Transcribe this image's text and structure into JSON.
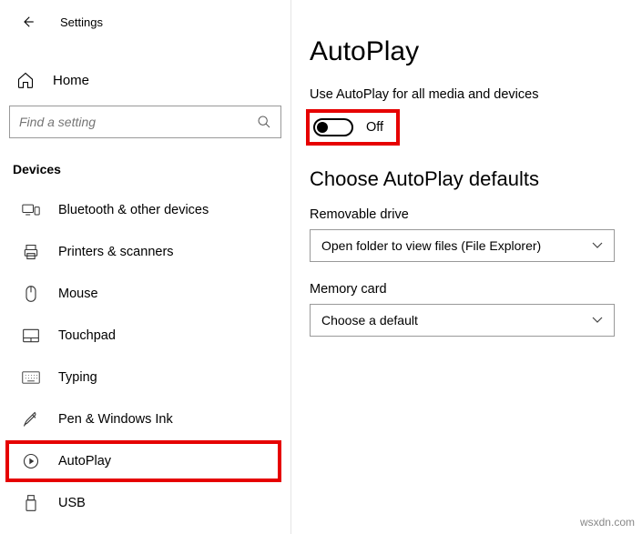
{
  "titlebar": {
    "title": "Settings"
  },
  "home": {
    "label": "Home"
  },
  "search": {
    "placeholder": "Find a setting"
  },
  "section": {
    "header": "Devices"
  },
  "nav": {
    "items": [
      {
        "label": "Bluetooth & other devices"
      },
      {
        "label": "Printers & scanners"
      },
      {
        "label": "Mouse"
      },
      {
        "label": "Touchpad"
      },
      {
        "label": "Typing"
      },
      {
        "label": "Pen & Windows Ink"
      },
      {
        "label": "AutoPlay"
      },
      {
        "label": "USB"
      }
    ]
  },
  "page": {
    "title": "AutoPlay",
    "toggle_desc": "Use AutoPlay for all media and devices",
    "toggle_state_label": "Off",
    "defaults_header": "Choose AutoPlay defaults",
    "removable_label": "Removable drive",
    "removable_value": "Open folder to view files (File Explorer)",
    "memcard_label": "Memory card",
    "memcard_value": "Choose a default"
  },
  "watermark": "wsxdn.com"
}
